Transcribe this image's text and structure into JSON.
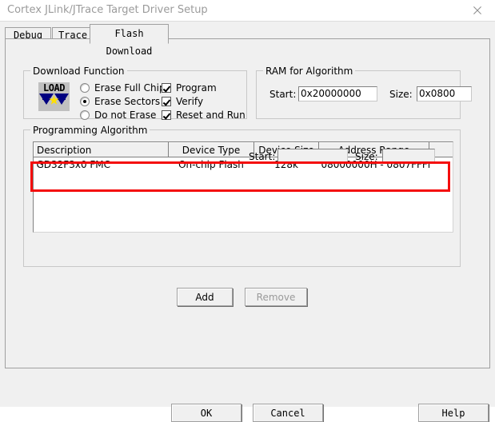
{
  "window": {
    "title": "Cortex JLink/JTrace Target Driver Setup",
    "close_icon": "close-icon"
  },
  "tabs": [
    {
      "id": "debug",
      "label": "Debug",
      "active": false
    },
    {
      "id": "trace",
      "label": "Trace",
      "active": false
    },
    {
      "id": "flash",
      "label": "Flash Download",
      "active": true
    }
  ],
  "download_function": {
    "legend": "Download Function",
    "icon": "load-flash-icon",
    "icon_text": "LOAD",
    "erase_options": [
      {
        "label": "Erase Full Chip",
        "selected": false
      },
      {
        "label": "Erase Sectors",
        "selected": true
      },
      {
        "label": "Do not Erase",
        "selected": false
      }
    ],
    "checkboxes": [
      {
        "label": "Program",
        "checked": true
      },
      {
        "label": "Verify",
        "checked": true
      },
      {
        "label": "Reset and Run",
        "checked": true
      }
    ]
  },
  "ram_for_algorithm": {
    "legend": "RAM for Algorithm",
    "start_label": "Start:",
    "start_value": "0x20000000",
    "size_label": "Size:",
    "size_value": "0x0800"
  },
  "programming_algorithm": {
    "legend": "Programming Algorithm",
    "columns": [
      "Description",
      "Device Type",
      "Device Size",
      "Address Range",
      ""
    ],
    "rows": [
      {
        "description": "GD32F3x0 FMC",
        "device_type": "On-chip Flash",
        "device_size": "128k",
        "address_range": "08000000H - 0807FFFFH"
      }
    ],
    "start_label": "Start:",
    "start_value": "",
    "size_label": "Size:",
    "size_value": "",
    "add_label": "Add",
    "remove_label": "Remove",
    "remove_enabled": false,
    "highlight_color": "#f40d0d"
  },
  "footer": {
    "ok_label": "OK",
    "cancel_label": "Cancel",
    "help_label": "Help"
  }
}
